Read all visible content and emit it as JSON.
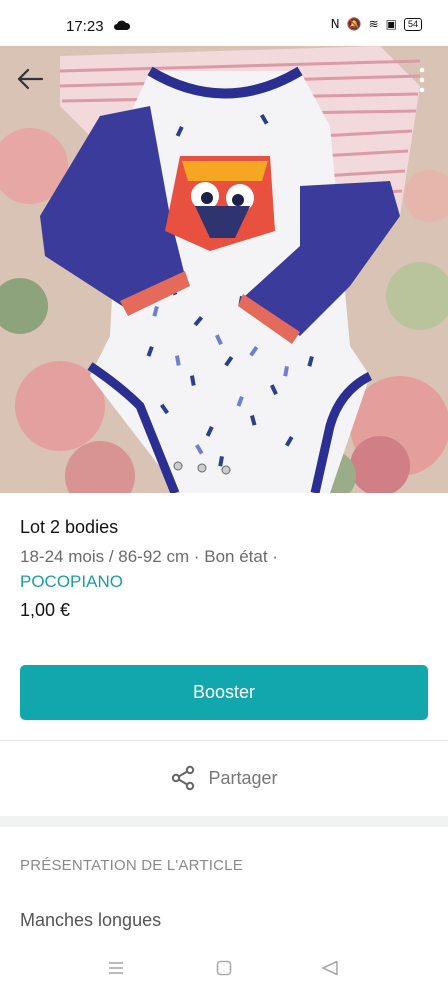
{
  "status_bar": {
    "time": "17:23",
    "nfc": "N",
    "mute": "🔕",
    "wifi": "≋",
    "sim": "▣",
    "battery": "54"
  },
  "photo": {
    "back_icon": "arrow-left-icon",
    "more_icon": "more-vertical-icon"
  },
  "item": {
    "title": "Lot 2 bodies",
    "meta": "18-24 mois / 86-92 cm · Bon état ·",
    "brand": "POCOPIANO",
    "price": "1,00 €"
  },
  "actions": {
    "boost_label": "Booster",
    "share_label": "Partager"
  },
  "section": {
    "title": "PRÉSENTATION DE L'ARTICLE",
    "sleeve": "Manches longues"
  },
  "colors": {
    "accent": "#11a7ad",
    "brand_text": "#1a9ea4"
  }
}
